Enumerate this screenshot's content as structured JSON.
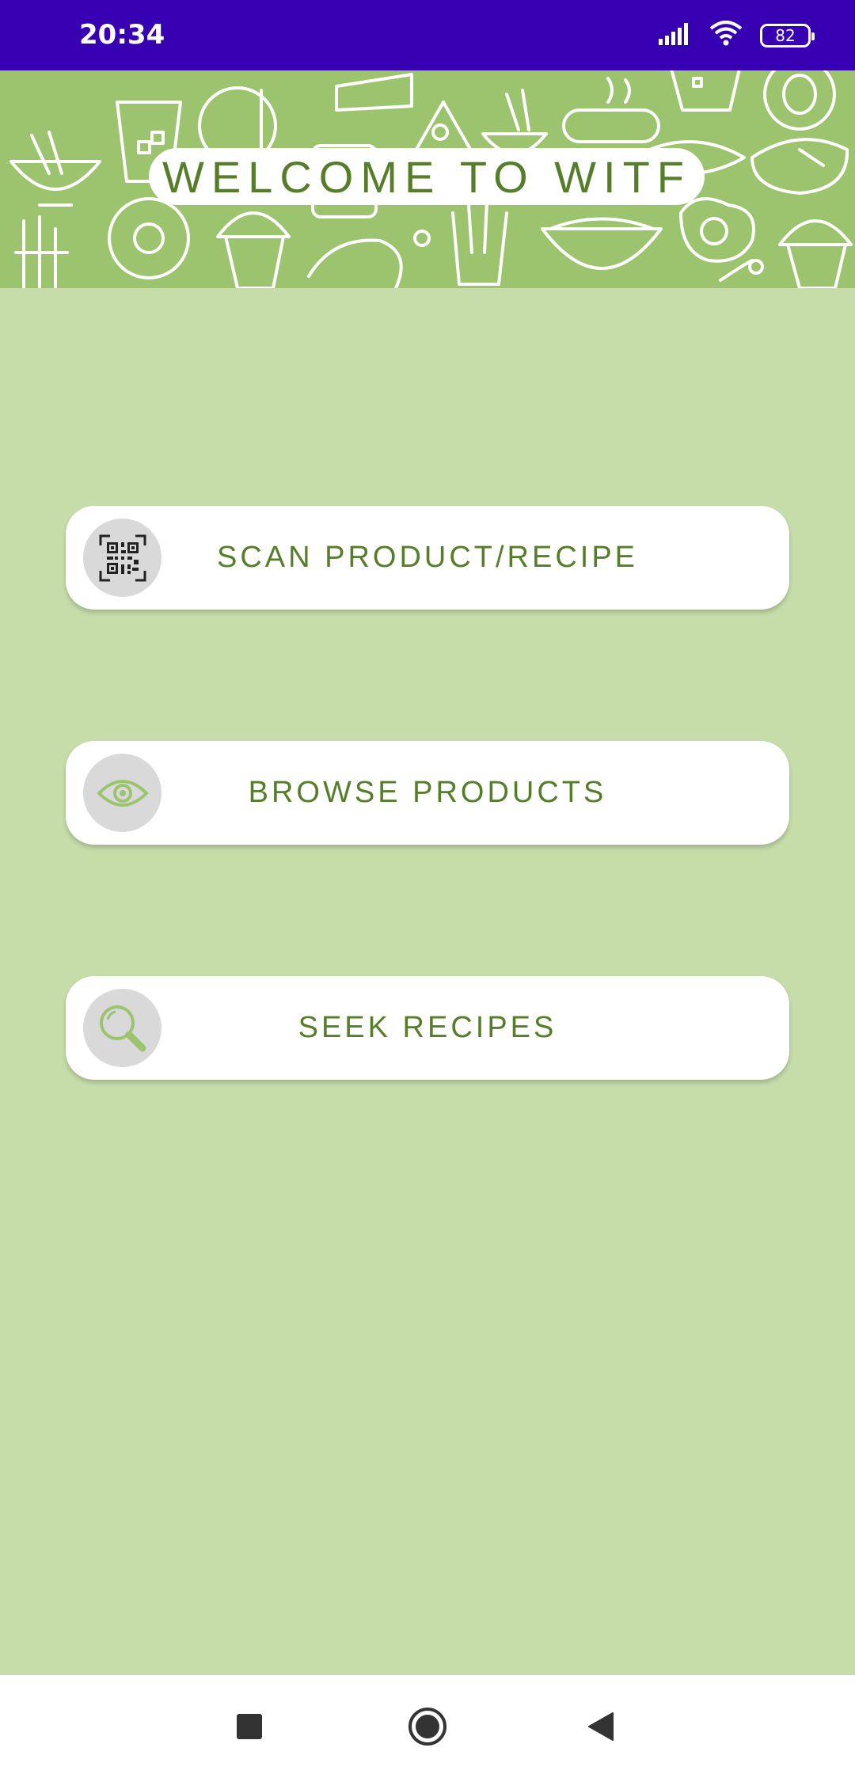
{
  "status_bar": {
    "time": "20:34",
    "battery": "82",
    "icons": [
      "signal-icon",
      "wifi-icon",
      "battery-icon"
    ]
  },
  "header": {
    "title": "WELCOME TO WITF"
  },
  "actions": [
    {
      "label": "SCAN PRODUCT/RECIPE",
      "icon": "qr-code-icon"
    },
    {
      "label": "BROWSE PRODUCTS",
      "icon": "eye-icon"
    },
    {
      "label": "SEEK RECIPES",
      "icon": "search-icon"
    }
  ],
  "nav_bar": {
    "buttons": [
      "recents-square-icon",
      "home-circle-icon",
      "back-triangle-icon"
    ]
  },
  "colors": {
    "status_bar": "#3700b3",
    "banner": "#9cc46f",
    "background": "#c6ddaa",
    "accent_text": "#567d2a",
    "icon_green": "#9cc46f"
  }
}
